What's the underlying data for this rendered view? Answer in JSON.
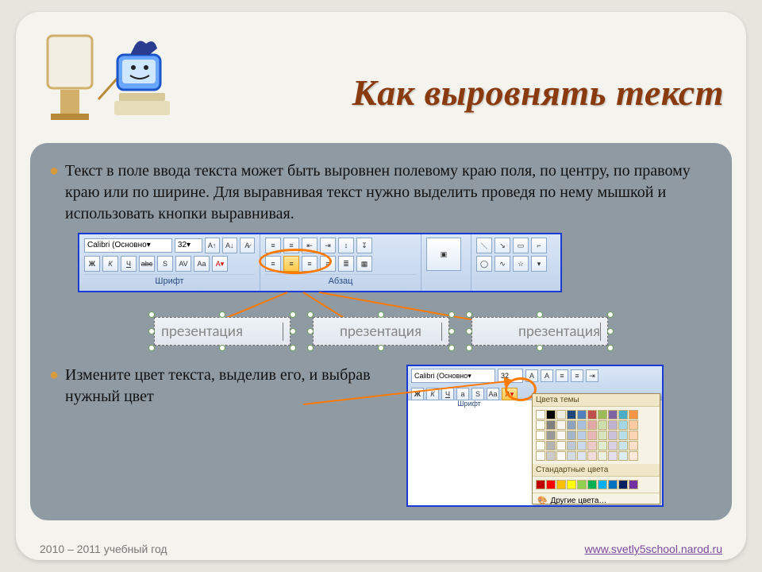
{
  "title": "Как выровнять текст",
  "bullets": [
    "Текст в поле ввода текста может быть выровнен полевому краю поля, по центру, по правому краю или по ширине. Для выравнивая текст нужно выделить проведя по нему мышкой и использовать кнопки выравнивая.",
    "Измените цвет текста, выделив его, и выбрав нужный цвет"
  ],
  "ribbon": {
    "font_combo": "Calibri (Основно",
    "size_combo": "32",
    "pane_font": "Шрифт",
    "pane_paragraph": "Абзац",
    "bold": "Ж",
    "italic": "К",
    "underline": "Ч",
    "strike": "abc",
    "shadow": "S",
    "av": "AV",
    "aa": "Aa",
    "a_red": "A"
  },
  "examples": {
    "left": "презентация",
    "center": "презентация",
    "right": "презентация"
  },
  "color_picker": {
    "header1": "Цвета темы",
    "header2": "Стандартные цвета",
    "more": "Другие цвета…",
    "pane_font": "Шрифт"
  },
  "footer": {
    "year": "2010 – 2011 учебный год",
    "link": "www.svetly5school.narod.ru"
  },
  "colors": {
    "theme_row": [
      "#ffffff",
      "#000000",
      "#eeece1",
      "#1f497d",
      "#4f81bd",
      "#c0504d",
      "#9bbb59",
      "#8064a2",
      "#4bacc6",
      "#f79646"
    ],
    "std_row": [
      "#c00000",
      "#ff0000",
      "#ffc000",
      "#ffff00",
      "#92d050",
      "#00b050",
      "#00b0f0",
      "#0070c0",
      "#002060",
      "#7030a0"
    ]
  }
}
